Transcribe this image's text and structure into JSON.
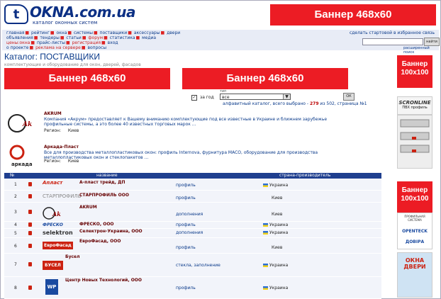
{
  "header": {
    "logo_mark": "t",
    "logo_text": "OKNA.com.ua",
    "logo_sub": "каталог оконных систем",
    "top_banner": "Баннер 468x60"
  },
  "nav": {
    "line1": [
      "главная",
      "рейтинг",
      "окна",
      "системы",
      "поставщики",
      "аксессуары",
      "двери"
    ],
    "line2": [
      "объявления",
      "тендеры",
      "статьи",
      "форум",
      "статистика",
      "медиа"
    ],
    "line3": [
      "цены:окна",
      "прайс-листы",
      "регистрация",
      "вход"
    ],
    "line4": [
      "о проекте",
      "реклама на сервере",
      "вопросы"
    ],
    "right_links": "сделать стартовой  в избранное  связь",
    "search_button": "найти",
    "advanced_search": "расширенный поиск"
  },
  "page": {
    "title": "Каталог: ПОСТАВЩИКИ",
    "subtitle": "комплектующие и оборудование для окон, дверей, фасадов",
    "banner1": "Баннер 468x60",
    "banner2": "Баннер 468x60"
  },
  "filter": {
    "checkbox_label": "за год",
    "type_label": "тип",
    "select_value": "все",
    "ok_button": "ОК",
    "counts_prefix": "алфавитный каталог, всего выбрано -",
    "count": "279",
    "counts_suffix": "из 502, страница №1"
  },
  "featured": [
    {
      "name": "AKRUM",
      "description": "Компания «Акрум» предоставляет к Вашему вниманию комплектующие под все известные в Украине и ближнем зарубежье профильные системы, а это более 40 известных торговых марок ...",
      "region_label": "Регион:",
      "region": "Киев",
      "logo_text": "AKRUM"
    },
    {
      "name": "Аркада-Пласт",
      "description": "Все для производства металлопластиковых окон: профиль Internova, фурнитура MACO, оборудование для производства металлопластиковых окон и стеклопакетов ...",
      "region_label": "Регион:",
      "region": "Киев",
      "logo_text": "аркада пласт"
    }
  ],
  "table": {
    "headers": [
      "№",
      "название",
      "",
      "страна-производитель"
    ],
    "rows": [
      {
        "num": "1",
        "logo": "Апласт",
        "name": "А-пласт трейд, ДП",
        "type": "профиль",
        "country": "Украина",
        "city": ""
      },
      {
        "num": "2",
        "logo": "СТАРПРОФИЛЬ",
        "name": "СТАРПРОФИЛЬ ООО",
        "type": "профиль",
        "country": "",
        "city": "Киев"
      },
      {
        "num": "3",
        "logo": "AKRUM",
        "name": "AKRUM",
        "type": "дополнения",
        "country": "",
        "city": "Киев"
      },
      {
        "num": "4",
        "logo": "ФРЕСКО",
        "name": "ФРЕСКО, ООО",
        "type": "профиль",
        "country": "Украина",
        "city": ""
      },
      {
        "num": "5",
        "logo": "selektron",
        "name": "Селектрон-Украина, ООО",
        "type": "дополнения",
        "country": "Украина",
        "city": ""
      },
      {
        "num": "6",
        "logo": "ЕвроФасад",
        "name": "ЕвроФасад, ООО",
        "type": "профиль",
        "country": "",
        "city": "Киев"
      },
      {
        "num": "7",
        "logo": "БУСЕЛ",
        "name": "Бусел",
        "type": "стекла, заполнение",
        "country": "Украина",
        "city": ""
      },
      {
        "num": "8",
        "logo": "WP",
        "name": "Центр Новых Технологий, ООО",
        "type": "профиль",
        "country": "Украина",
        "city": ""
      }
    ]
  },
  "right_column": {
    "banner_top": "Баннер 100x100",
    "scronline": "SCRONLINE",
    "scronline_sub": "ПВХ профиль",
    "banner_mid": "Баннер 100x100",
    "openteck_title": "ПРОФИЛЬНАЯ СИСТЕМА",
    "openteck": "OPENTECK",
    "openteck_sub": "ДОВІРА",
    "okna_dveri": "ОКНА ДВЕРИ"
  },
  "colors": {
    "accent_red": "#ec1c24",
    "nav_blue": "#0a3a8a",
    "table_header": "#1f3f8f"
  }
}
